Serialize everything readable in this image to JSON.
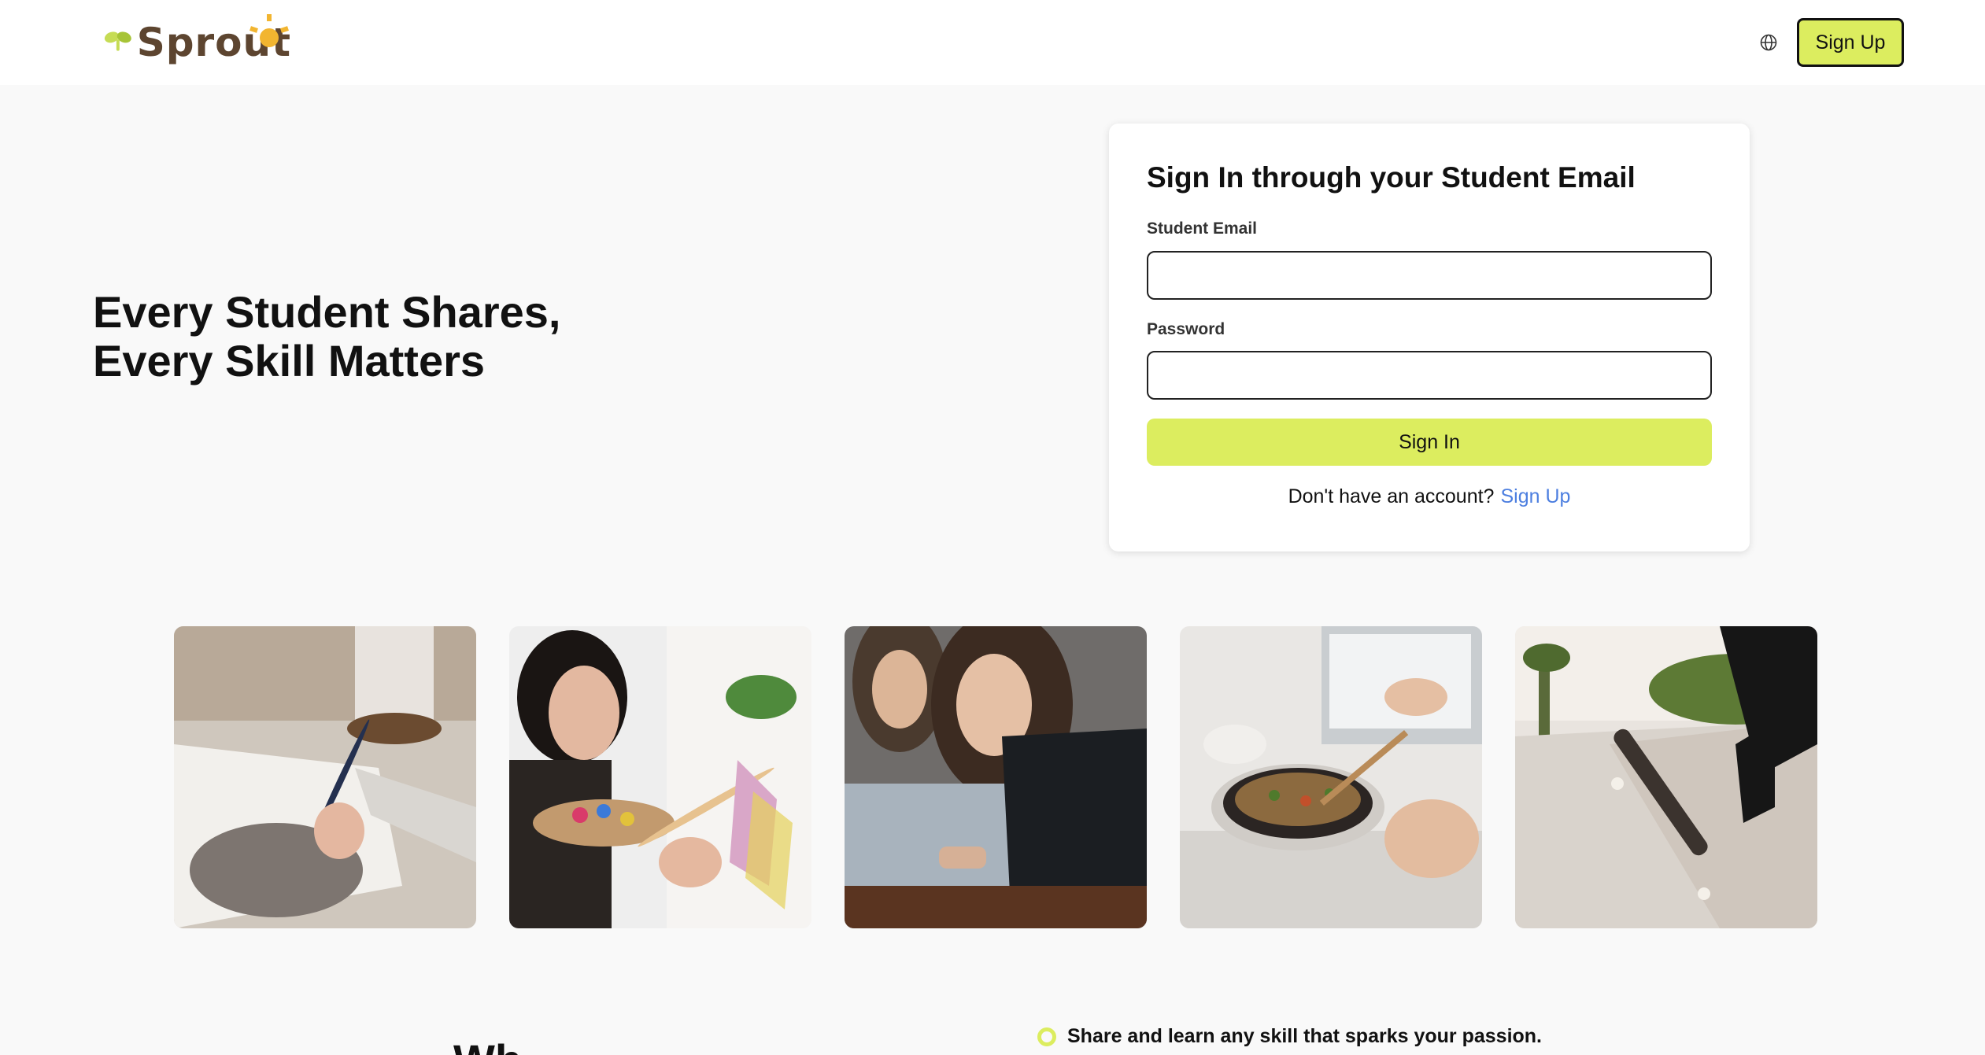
{
  "header": {
    "brand": "Sprout",
    "globe_icon": "globe-icon",
    "signup_label": "Sign Up",
    "accent_color": "#dced5f"
  },
  "hero": {
    "line1": "Every Student Shares,",
    "line2": "Every Skill Matters"
  },
  "signin": {
    "title": "Sign In through your Student Email",
    "email_label": "Student Email",
    "email_value": "",
    "password_label": "Password",
    "password_value": "",
    "button_label": "Sign In",
    "no_account_text": "Don't have an account?",
    "signup_link": "Sign Up",
    "link_color": "#4d7fe0"
  },
  "gallery": [
    {
      "icon": "writing-photo"
    },
    {
      "icon": "painting-photo"
    },
    {
      "icon": "laptop-photo"
    },
    {
      "icon": "cooking-photo"
    },
    {
      "icon": "skateboarding-photo"
    }
  ],
  "features": {
    "heading_partial": "Wh",
    "bullet1": "Share and learn any skill that sparks your passion."
  }
}
